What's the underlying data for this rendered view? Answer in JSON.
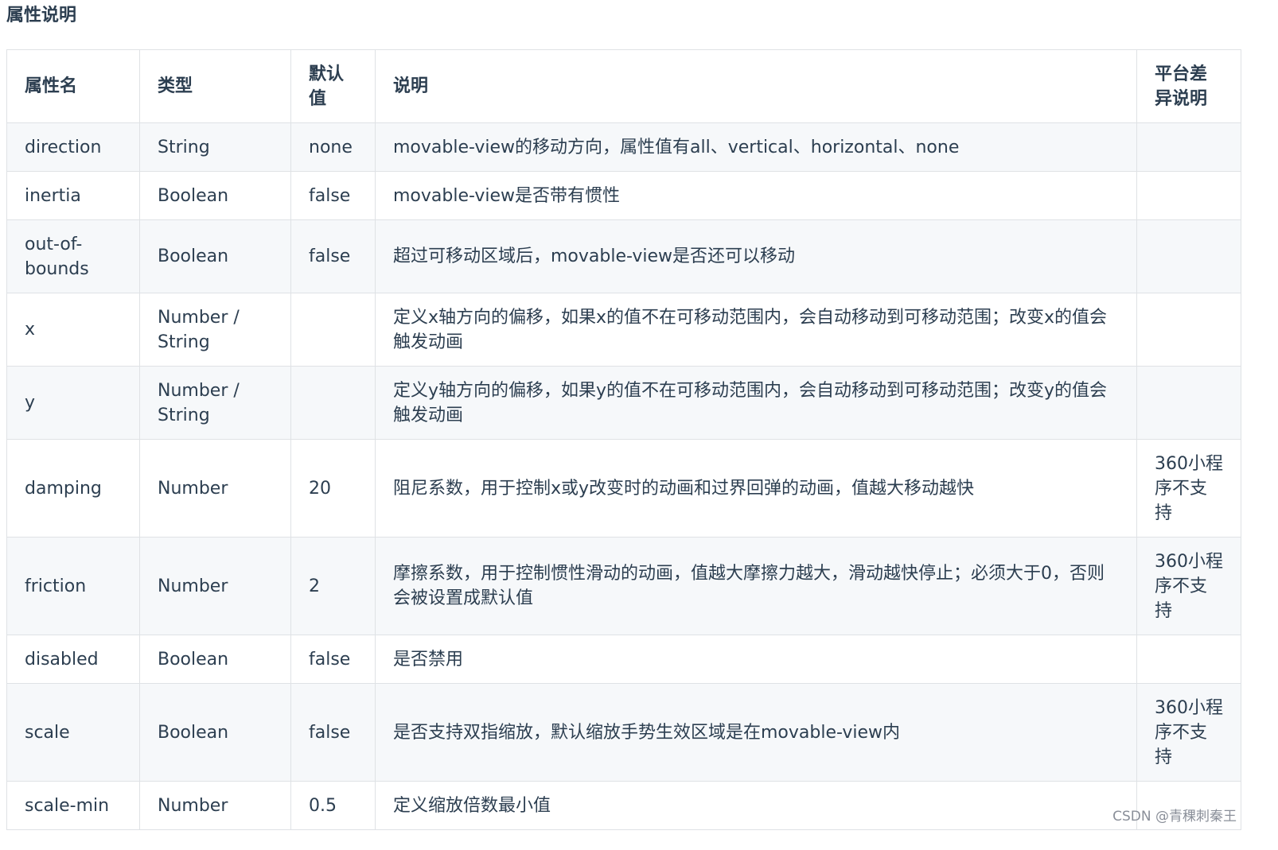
{
  "section_title": "属性说明",
  "table": {
    "headers": {
      "name": "属性名",
      "type": "类型",
      "default": "默认值",
      "desc": "说明",
      "platform": "平台差异说明"
    },
    "rows": [
      {
        "name": "direction",
        "type": "String",
        "default": "none",
        "desc": "movable-view的移动方向，属性值有all、vertical、horizontal、none",
        "platform": ""
      },
      {
        "name": "inertia",
        "type": "Boolean",
        "default": "false",
        "desc": "movable-view是否带有惯性",
        "platform": ""
      },
      {
        "name": "out-of-bounds",
        "type": "Boolean",
        "default": "false",
        "desc": "超过可移动区域后，movable-view是否还可以移动",
        "platform": ""
      },
      {
        "name": "x",
        "type": "Number / String",
        "default": "",
        "desc": "定义x轴方向的偏移，如果x的值不在可移动范围内，会自动移动到可移动范围；改变x的值会触发动画",
        "platform": ""
      },
      {
        "name": "y",
        "type": "Number / String",
        "default": "",
        "desc": "定义y轴方向的偏移，如果y的值不在可移动范围内，会自动移动到可移动范围；改变y的值会触发动画",
        "platform": ""
      },
      {
        "name": "damping",
        "type": "Number",
        "default": "20",
        "desc": "阻尼系数，用于控制x或y改变时的动画和过界回弹的动画，值越大移动越快",
        "platform": "360小程序不支持"
      },
      {
        "name": "friction",
        "type": "Number",
        "default": "2",
        "desc": "摩擦系数，用于控制惯性滑动的动画，值越大摩擦力越大，滑动越快停止；必须大于0，否则会被设置成默认值",
        "platform": "360小程序不支持"
      },
      {
        "name": "disabled",
        "type": "Boolean",
        "default": "false",
        "desc": "是否禁用",
        "platform": ""
      },
      {
        "name": "scale",
        "type": "Boolean",
        "default": "false",
        "desc": "是否支持双指缩放，默认缩放手势生效区域是在movable-view内",
        "platform": "360小程序不支持"
      },
      {
        "name": "scale-min",
        "type": "Number",
        "default": "0.5",
        "desc": "定义缩放倍数最小值",
        "platform": ""
      }
    ]
  },
  "watermark": "CSDN @青稞刺秦王"
}
